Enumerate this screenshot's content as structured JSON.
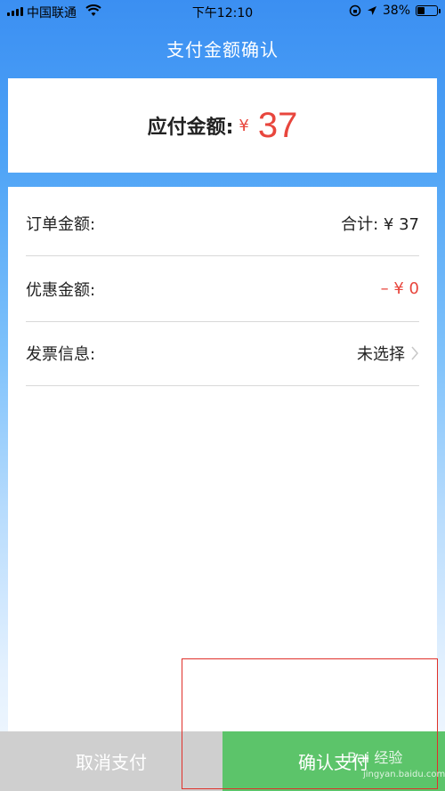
{
  "status_bar": {
    "carrier": "中国联通",
    "time": "下午12:10",
    "battery": "38%",
    "battery_level": 0.38
  },
  "header": {
    "title": "支付金额确认"
  },
  "amount": {
    "label": "应付金额:",
    "currency": "¥",
    "value": "37"
  },
  "details": {
    "order": {
      "label": "订单金额:",
      "value": "合计: ¥ 37"
    },
    "discount": {
      "label": "优惠金额:",
      "value": "– ¥ 0"
    },
    "invoice": {
      "label": "发票信息:",
      "value": "未选择"
    }
  },
  "footer": {
    "cancel_label": "取消支付",
    "confirm_label": "确认支付"
  },
  "watermark": {
    "text": "Bai 经验",
    "url_text": "jingyan.baidu.com"
  },
  "colors": {
    "accent_red": "#e8463d",
    "confirm_green": "#5cc46a",
    "cancel_gray": "#cfcfcf",
    "header_blue": "#3b8ff2"
  }
}
